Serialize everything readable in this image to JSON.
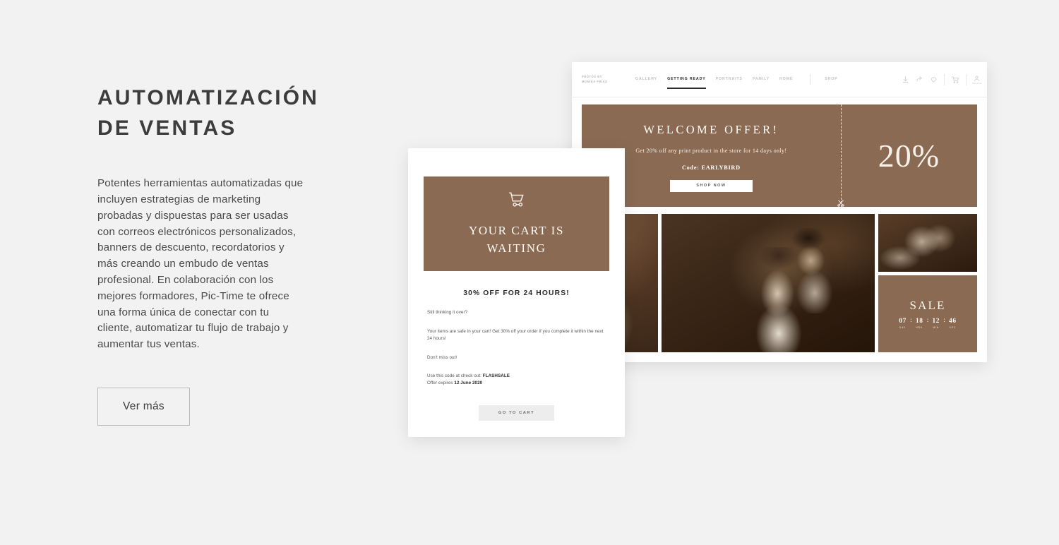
{
  "left": {
    "headline": "AUTOMATIZACIÓN\nDE VENTAS",
    "body": "Potentes herramientas automatizadas que incluyen estrategias de marketing probadas y dispuestas para ser usadas con correos electrónicos personalizados, banners de descuento, recordatorios y más creando un embudo de ventas profesional. En colaboración con los mejores formadores, Pic-Time te ofrece una forma única de conectar con tu cliente, automatizar tu flujo de trabajo y aumentar tus ventas.",
    "cta_label": "Ver más"
  },
  "site": {
    "logo": "PHOTOS BY\nMONIKA FRIAS",
    "nav": [
      {
        "label": "GALLERY",
        "active": false
      },
      {
        "label": "GETTING READY",
        "active": true
      },
      {
        "label": "PORTRAITS",
        "active": false
      },
      {
        "label": "FAMILY",
        "active": false
      },
      {
        "label": "HOME",
        "active": false
      }
    ],
    "nav_shop": "SHOP",
    "icons": [
      "download-icon",
      "share-icon",
      "heart-icon",
      "cart-icon",
      "user-icon"
    ],
    "avatar_label": "PROFILE",
    "offer": {
      "title": "WELCOME OFFER!",
      "subtitle": "Get 20% off any print product in the store for 14 days only!",
      "code_line": "Code: EARLYBIRD",
      "button": "SHOP NOW",
      "percent": "20%"
    },
    "sale": {
      "title": "SALE",
      "countdown": [
        {
          "value": "07",
          "label": "DAY"
        },
        {
          "value": "18",
          "label": "HRS"
        },
        {
          "value": "12",
          "label": "MIN"
        },
        {
          "value": "46",
          "label": "SEC"
        }
      ],
      "separator": ":"
    }
  },
  "email": {
    "hero_title": "YOUR CART IS\nWAITING",
    "offer_headline": "30% OFF FOR 24 HOURS!",
    "p1": "Still thinking it over?",
    "p2": "Your items are safe in your cart! Get 30% off your order if you complete it within the next 24 hours!",
    "p3": "Don't miss out!",
    "p4_prefix": "Use this code at check out: ",
    "p4_code": "FLASHSALE",
    "p5_prefix": "Offer expires ",
    "p5_date": "12 June 2020",
    "cta": "GO TO CART"
  },
  "colors": {
    "brand_brown": "#8a6a53",
    "page_bg": "#f2f2f2",
    "text_dark": "#3c3c3c"
  }
}
